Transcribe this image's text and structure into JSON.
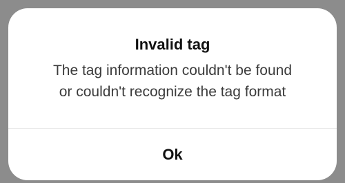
{
  "dialog": {
    "title": "Invalid tag",
    "message_lines": [
      "The tag information couldn't be found",
      "or couldn't recognize the tag format"
    ],
    "ok_label": "Ok"
  }
}
